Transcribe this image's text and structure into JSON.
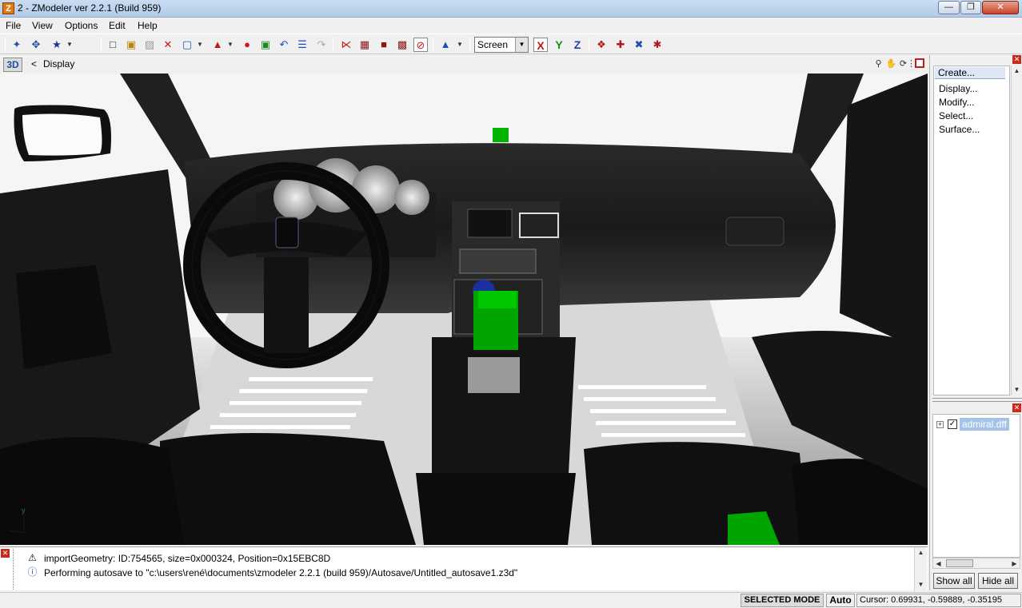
{
  "window": {
    "title": "2 - ZModeler ver 2.2.1 (Build 959)",
    "app_icon": "Z"
  },
  "menu": [
    "File",
    "View",
    "Options",
    "Edit",
    "Help"
  ],
  "toolbar": {
    "coordinate_mode": "Screen",
    "axes": [
      "X",
      "Y",
      "Z"
    ],
    "icons": [
      "select-icon",
      "select-move-icon",
      "pose-icon",
      "new-file-icon",
      "open-file-icon",
      "save-icon",
      "delete-icon",
      "import-icon",
      "export-icon",
      "record-icon",
      "object-icon",
      "undo-icon",
      "list-icon",
      "redo-icon",
      "vertex-mode-icon",
      "box-mode-icon",
      "cube-mode-icon",
      "mesh-mode-icon",
      "no-selection-icon",
      "axis-gizmo-icon",
      "render-icon",
      "move-tool-icon",
      "rotate-tool-icon",
      "scale-tool-icon"
    ]
  },
  "viewport": {
    "mode_button": "3D",
    "back_glyph": "<",
    "label": "Display",
    "tools": [
      "zoom-icon",
      "pan-icon",
      "rotate-view-icon",
      "grip-icon"
    ],
    "axis_gizmo_label": "y"
  },
  "command_panel": {
    "items": [
      {
        "label": "Create...",
        "active": true
      },
      {
        "label": "Display...",
        "active": false
      },
      {
        "label": "Modify...",
        "active": false
      },
      {
        "label": "Select...",
        "active": false
      },
      {
        "label": "Surface...",
        "active": false
      }
    ]
  },
  "scene_tree": {
    "expand_glyph": "+",
    "file": "admiral.dff",
    "checked": true
  },
  "scene_buttons": {
    "show_all": "Show all",
    "hide_all": "Hide all"
  },
  "log": [
    {
      "icon": "warning-icon",
      "text": "importGeometry: ID:754565, size=0x000324, Position=0x15EBC8D"
    },
    {
      "icon": "info-icon",
      "text": "Performing autosave to \"c:\\users\\rené\\documents\\zmodeler 2.2.1 (build 959)/Autosave/Untitled_autosave1.z3d\""
    }
  ],
  "status": {
    "mode": "SELECTED MODE",
    "auto": "Auto",
    "cursor": "Cursor: 0.69931, -0.59889, -0.35195"
  },
  "colors": {
    "accent_selection": "#a5c2e8",
    "helper_green": "#00b400",
    "close_red": "#c72b1d"
  }
}
